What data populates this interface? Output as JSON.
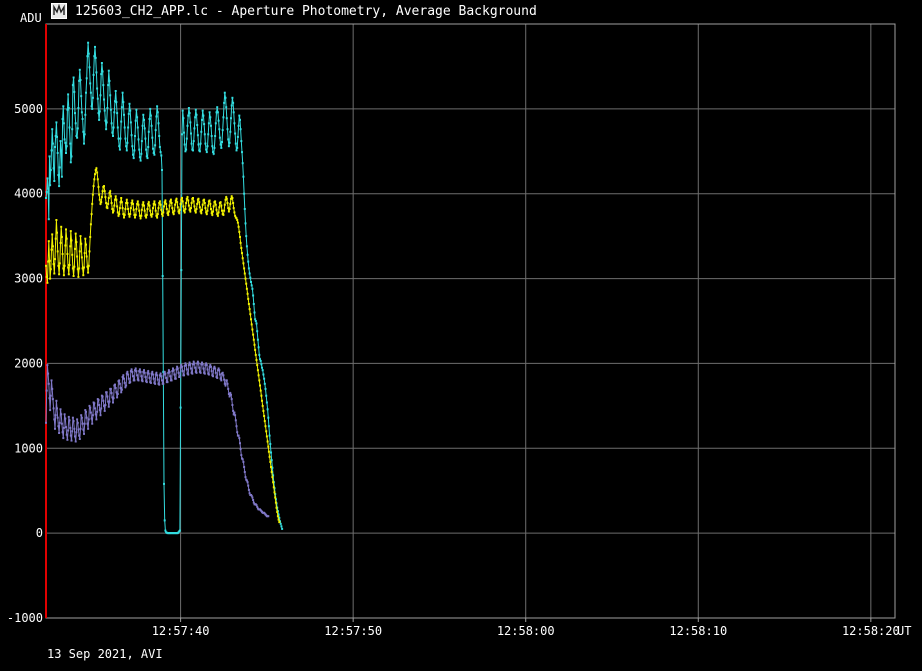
{
  "window": {
    "title": "125603_CH2_APP.lc - Aperture Photometry, Average Background",
    "icon": "lightcurve-app-icon"
  },
  "footer": {
    "note": "13 Sep 2021, AVI"
  },
  "colors": {
    "background": "#000000",
    "grid": "#6e6e6e",
    "axis": "#a0a0a0",
    "text": "#ffffff",
    "cursor": "#e00000"
  },
  "chart_data": {
    "type": "line",
    "title": "",
    "xlabel": "UT",
    "ylabel": "ADU",
    "xlim": [
      "12:57:32.2",
      "12:58:21.4"
    ],
    "ylim": [
      -1000,
      6000
    ],
    "grid": true,
    "legend": "none",
    "x_ticks": [
      "12:57:40",
      "12:57:50",
      "12:58:00",
      "12:58:10",
      "12:58:20"
    ],
    "y_ticks": [
      -1000,
      0,
      1000,
      2000,
      3000,
      4000,
      5000
    ],
    "x_start": "12:57:32.2",
    "sample_interval_s": 0.04,
    "series": [
      {
        "color": "#33dde0",
        "stride": 1,
        "values": [
          3950,
          4020,
          4180,
          4060,
          3700,
          4440,
          4100,
          4280,
          4510,
          4760,
          4590,
          4300,
          4150,
          4550,
          4680,
          4840,
          4670,
          4480,
          4220,
          4090,
          4310,
          4620,
          4510,
          4200,
          4880,
          5030,
          4830,
          4640,
          4600,
          4480,
          4560,
          4990,
          5170,
          5010,
          4780,
          4590,
          4370,
          4440,
          4760,
          5280,
          5370,
          5200,
          4950,
          4830,
          4680,
          4660,
          4770,
          5010,
          5330,
          5460,
          5340,
          5150,
          4960,
          4880,
          4730,
          4590,
          4700,
          4930,
          5190,
          5360,
          5620,
          5780,
          5650,
          5490,
          5300,
          5190,
          5030,
          5000,
          5130,
          5400,
          5620,
          5730,
          5600,
          5430,
          5240,
          5120,
          4950,
          4870,
          4970,
          5160,
          5410,
          5540,
          5440,
          5280,
          5110,
          4980,
          4860,
          4760,
          4840,
          5010,
          5280,
          5450,
          5330,
          5160,
          4990,
          4830,
          4720,
          4680,
          4780,
          4960,
          5090,
          5210,
          5080,
          4950,
          4780,
          4650,
          4560,
          4520,
          4650,
          4850,
          5020,
          5190,
          5080,
          4930,
          4780,
          4650,
          4560,
          4510,
          4600,
          4780,
          4940,
          5060,
          4980,
          4840,
          4690,
          4560,
          4460,
          4420,
          4510,
          4680,
          4860,
          4990,
          4900,
          4780,
          4640,
          4520,
          4430,
          4390,
          4470,
          4620,
          4800,
          4930,
          4870,
          4770,
          4650,
          4520,
          4440,
          4420,
          4550,
          4730,
          4880,
          5000,
          4920,
          4800,
          4660,
          4530,
          4480,
          4460,
          4570,
          4750,
          4910,
          5030,
          4960,
          4830,
          4680,
          4550,
          4490,
          4450,
          4280,
          3030,
          1900,
          580,
          150,
          30,
          10,
          5,
          0,
          0,
          0,
          0,
          0,
          0,
          0,
          0,
          0,
          0,
          0,
          0,
          0,
          0,
          0,
          0,
          10,
          20,
          30,
          1480,
          3100,
          4700,
          4980,
          4890,
          4720,
          4580,
          4500,
          4520,
          4650,
          4800,
          4920,
          5010,
          4950,
          4840,
          4710,
          4590,
          4520,
          4510,
          4620,
          4770,
          4900,
          4990,
          4930,
          4810,
          4690,
          4580,
          4510,
          4500,
          4590,
          4730,
          4870,
          4980,
          4920,
          4820,
          4700,
          4590,
          4520,
          4490,
          4560,
          4700,
          4830,
          4960,
          4900,
          4800,
          4680,
          4560,
          4490,
          4470,
          4540,
          4680,
          4830,
          4960,
          5020,
          4960,
          4860,
          4760,
          4660,
          4580,
          4540,
          4610,
          4750,
          4900,
          5070,
          5190,
          5130,
          5020,
          4890,
          4760,
          4640,
          4560,
          4600,
          4730,
          4890,
          5040,
          5130,
          5070,
          4960,
          4830,
          4710,
          4590,
          4510,
          4540,
          4670,
          4800,
          4920,
          4870,
          4760,
          4620,
          4490,
          4360,
          4200,
          4000,
          3820,
          3650,
          3500,
          3380,
          3280,
          3200,
          3120,
          3060,
          3010,
          2960,
          2920,
          2880,
          2800,
          2700,
          2600,
          2520,
          2500,
          2470,
          2380,
          2280,
          2190,
          2100,
          2050,
          2030,
          1990,
          1950,
          1920,
          1870,
          1820,
          1760,
          1700,
          1620,
          1540,
          1460,
          1360,
          1260,
          1150,
          1050,
          950,
          860,
          770,
          680,
          600,
          530,
          460,
          400,
          350,
          300,
          260,
          220,
          180,
          140,
          110,
          80,
          50
        ]
      },
      {
        "color": "#f2f200",
        "stride": 1,
        "values": [
          3150,
          3020,
          2950,
          3200,
          3440,
          3210,
          3000,
          3110,
          3340,
          3520,
          3380,
          3170,
          3060,
          3230,
          3470,
          3690,
          3540,
          3320,
          3150,
          3050,
          3180,
          3420,
          3610,
          3490,
          3290,
          3120,
          3040,
          3150,
          3390,
          3580,
          3470,
          3290,
          3130,
          3050,
          3160,
          3380,
          3560,
          3450,
          3280,
          3120,
          3030,
          3140,
          3350,
          3530,
          3430,
          3260,
          3110,
          3020,
          3120,
          3320,
          3500,
          3410,
          3250,
          3120,
          3040,
          3130,
          3300,
          3470,
          3400,
          3260,
          3140,
          3070,
          3150,
          3320,
          3490,
          3640,
          3760,
          3880,
          3990,
          4090,
          4170,
          4230,
          4280,
          4300,
          4250,
          4170,
          4080,
          3990,
          3930,
          3880,
          3900,
          3960,
          4030,
          4080,
          4090,
          4030,
          3960,
          3890,
          3840,
          3830,
          3880,
          3950,
          4010,
          4030,
          3970,
          3890,
          3820,
          3780,
          3800,
          3860,
          3930,
          3970,
          3930,
          3850,
          3780,
          3740,
          3760,
          3830,
          3900,
          3950,
          3900,
          3830,
          3760,
          3720,
          3750,
          3820,
          3890,
          3930,
          3890,
          3820,
          3760,
          3730,
          3760,
          3830,
          3890,
          3920,
          3880,
          3810,
          3750,
          3720,
          3750,
          3820,
          3880,
          3910,
          3870,
          3800,
          3740,
          3710,
          3740,
          3810,
          3870,
          3900,
          3860,
          3800,
          3740,
          3720,
          3750,
          3820,
          3880,
          3900,
          3860,
          3800,
          3750,
          3730,
          3760,
          3830,
          3880,
          3910,
          3870,
          3800,
          3740,
          3720,
          3760,
          3830,
          3890,
          3910,
          3870,
          3810,
          3760,
          3740,
          3780,
          3850,
          3900,
          3920,
          3880,
          3820,
          3770,
          3750,
          3790,
          3860,
          3910,
          3930,
          3890,
          3830,
          3780,
          3760,
          3800,
          3870,
          3920,
          3940,
          3900,
          3840,
          3790,
          3770,
          3810,
          3880,
          3930,
          3950,
          3910,
          3850,
          3800,
          3780,
          3820,
          3890,
          3940,
          3960,
          3920,
          3860,
          3810,
          3790,
          3830,
          3890,
          3940,
          3950,
          3910,
          3850,
          3800,
          3780,
          3820,
          3880,
          3930,
          3940,
          3900,
          3840,
          3790,
          3770,
          3810,
          3870,
          3920,
          3930,
          3890,
          3830,
          3780,
          3760,
          3800,
          3860,
          3910,
          3920,
          3880,
          3820,
          3770,
          3750,
          3790,
          3850,
          3900,
          3910,
          3870,
          3810,
          3760,
          3740,
          3780,
          3840,
          3890,
          3900,
          3860,
          3800,
          3760,
          3750,
          3800,
          3870,
          3930,
          3960,
          3940,
          3890,
          3830,
          3790,
          3820,
          3880,
          3940,
          3970,
          3950,
          3890,
          3830,
          3780,
          3740,
          3720,
          3710,
          3690,
          3660,
          3610,
          3550,
          3490,
          3420,
          3360,
          3300,
          3240,
          3180,
          3120,
          3060,
          3000,
          2940,
          2880,
          2820,
          2760,
          2700,
          2640,
          2580,
          2520,
          2460,
          2400,
          2340,
          2280,
          2220,
          2160,
          2100,
          2040,
          1980,
          1920,
          1860,
          1800,
          1740,
          1680,
          1620,
          1560,
          1500,
          1440,
          1380,
          1320,
          1260,
          1200,
          1140,
          1080,
          1020,
          960,
          900,
          840,
          780,
          720,
          660,
          600,
          540,
          480,
          420,
          360,
          300,
          250,
          200,
          160,
          130
        ]
      },
      {
        "color": "#8078c8",
        "stride": 1,
        "values": [
          1300,
          1680,
          1980,
          1880,
          1760,
          1590,
          1450,
          1620,
          1800,
          1700,
          1580,
          1470,
          1340,
          1230,
          1390,
          1560,
          1470,
          1360,
          1260,
          1180,
          1300,
          1460,
          1400,
          1290,
          1190,
          1120,
          1240,
          1400,
          1350,
          1250,
          1160,
          1100,
          1210,
          1370,
          1330,
          1240,
          1150,
          1090,
          1200,
          1360,
          1320,
          1230,
          1140,
          1080,
          1190,
          1340,
          1300,
          1220,
          1150,
          1110,
          1230,
          1390,
          1360,
          1290,
          1220,
          1170,
          1290,
          1450,
          1430,
          1360,
          1290,
          1230,
          1340,
          1500,
          1480,
          1420,
          1350,
          1290,
          1390,
          1540,
          1530,
          1470,
          1400,
          1340,
          1430,
          1580,
          1570,
          1510,
          1450,
          1390,
          1470,
          1620,
          1610,
          1560,
          1500,
          1440,
          1510,
          1660,
          1660,
          1610,
          1550,
          1490,
          1550,
          1700,
          1700,
          1650,
          1600,
          1540,
          1590,
          1740,
          1750,
          1710,
          1660,
          1600,
          1640,
          1790,
          1800,
          1760,
          1710,
          1660,
          1690,
          1840,
          1860,
          1820,
          1770,
          1720,
          1740,
          1880,
          1900,
          1870,
          1820,
          1770,
          1780,
          1910,
          1930,
          1900,
          1850,
          1800,
          1800,
          1920,
          1940,
          1910,
          1860,
          1810,
          1800,
          1910,
          1930,
          1900,
          1850,
          1800,
          1790,
          1900,
          1920,
          1890,
          1840,
          1790,
          1780,
          1890,
          1910,
          1880,
          1830,
          1780,
          1770,
          1880,
          1900,
          1870,
          1820,
          1770,
          1760,
          1870,
          1890,
          1860,
          1810,
          1760,
          1750,
          1860,
          1880,
          1850,
          1800,
          1760,
          1760,
          1870,
          1900,
          1880,
          1830,
          1780,
          1780,
          1890,
          1920,
          1900,
          1850,
          1800,
          1800,
          1910,
          1940,
          1920,
          1870,
          1820,
          1820,
          1930,
          1960,
          1940,
          1890,
          1840,
          1840,
          1950,
          1980,
          1960,
          1910,
          1860,
          1860,
          1970,
          2000,
          1980,
          1930,
          1880,
          1870,
          1980,
          2010,
          1990,
          1940,
          1890,
          1880,
          1990,
          2020,
          2000,
          1950,
          1900,
          1890,
          2000,
          2020,
          2000,
          1950,
          1900,
          1890,
          1990,
          2010,
          1990,
          1940,
          1890,
          1880,
          1980,
          2000,
          1980,
          1930,
          1880,
          1870,
          1960,
          1980,
          1960,
          1910,
          1860,
          1850,
          1940,
          1960,
          1940,
          1890,
          1840,
          1830,
          1920,
          1940,
          1920,
          1870,
          1820,
          1800,
          1880,
          1890,
          1860,
          1810,
          1760,
          1740,
          1800,
          1800,
          1760,
          1700,
          1640,
          1610,
          1650,
          1630,
          1580,
          1510,
          1440,
          1400,
          1420,
          1390,
          1330,
          1260,
          1190,
          1150,
          1150,
          1120,
          1060,
          990,
          920,
          880,
          870,
          840,
          780,
          720,
          660,
          630,
          620,
          600,
          560,
          510,
          470,
          450,
          450,
          440,
          420,
          390,
          360,
          340,
          340,
          340,
          330,
          310,
          290,
          280,
          280,
          280,
          270,
          260,
          250,
          240,
          240,
          240,
          230,
          220,
          210,
          200,
          200,
          200
        ]
      }
    ]
  }
}
